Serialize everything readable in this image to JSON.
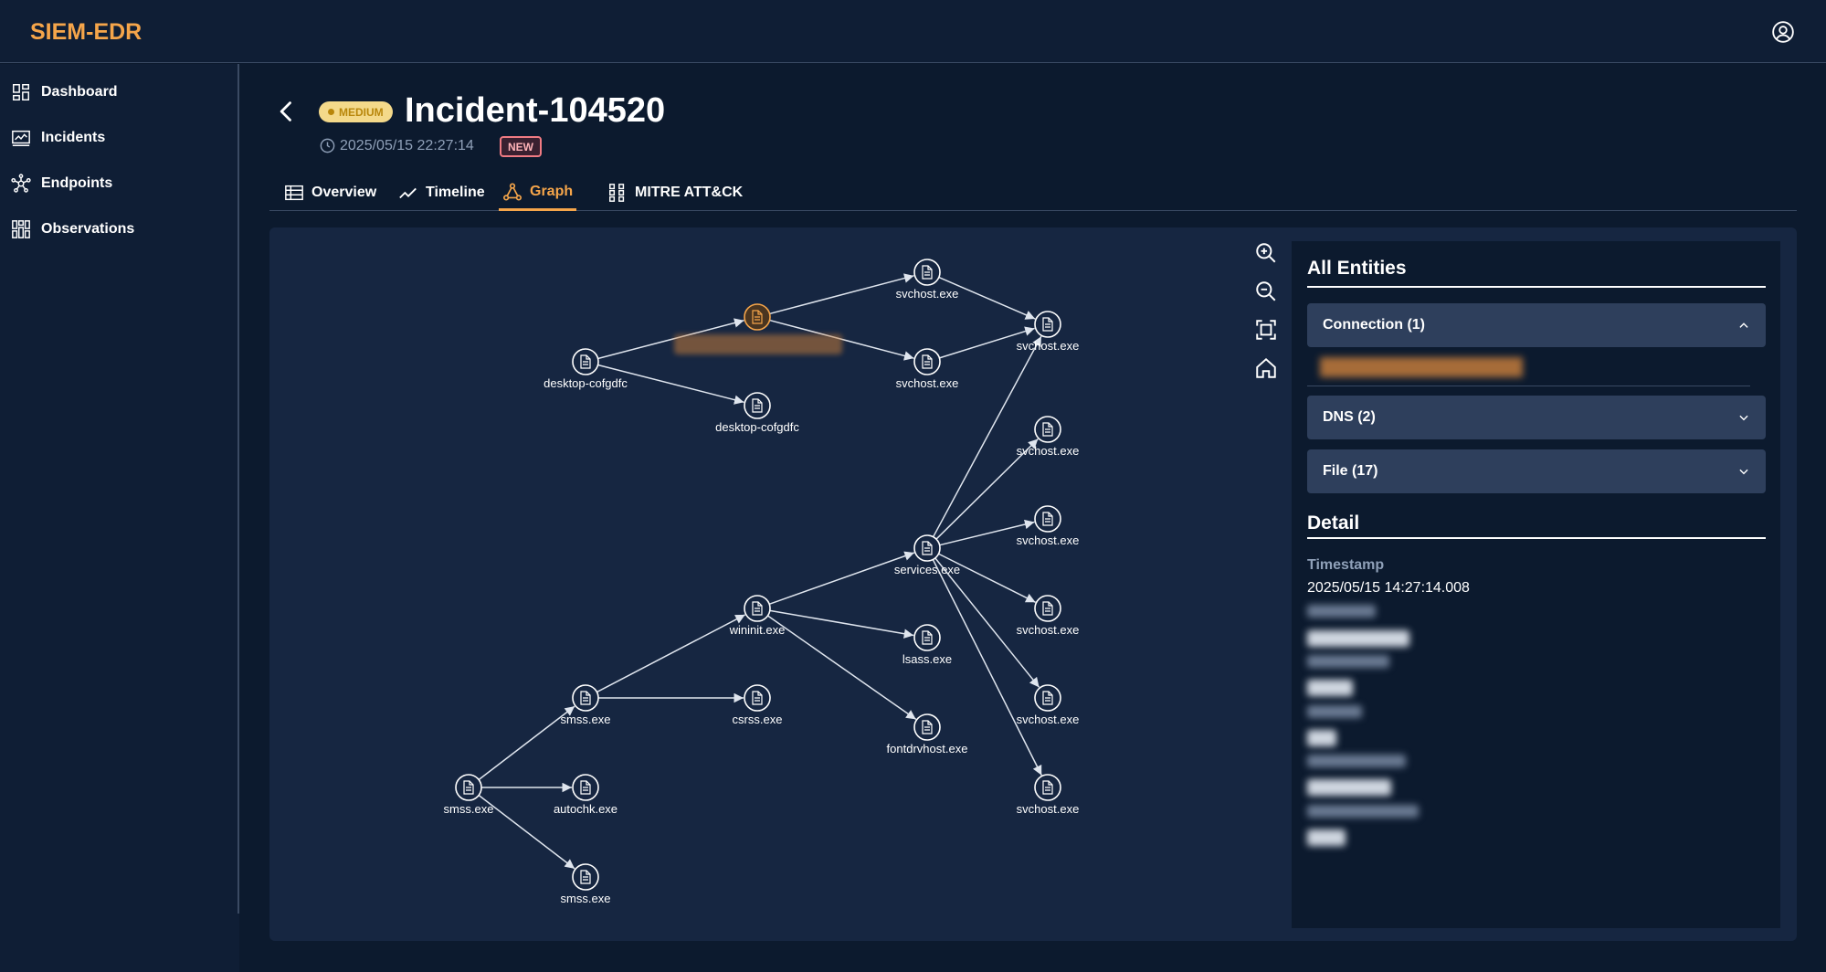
{
  "app": {
    "brand": "SIEM-EDR"
  },
  "sidebar": {
    "items": [
      {
        "label": "Dashboard",
        "icon": "dashboard-icon"
      },
      {
        "label": "Incidents",
        "icon": "chart-icon"
      },
      {
        "label": "Endpoints",
        "icon": "network-icon"
      },
      {
        "label": "Observations",
        "icon": "grid-icon"
      }
    ]
  },
  "incident": {
    "severity": "MEDIUM",
    "title": "Incident-104520",
    "timestamp": "2025/05/15 22:27:14",
    "status": "NEW"
  },
  "tabs": [
    {
      "label": "Overview",
      "icon": "table-icon",
      "active": false
    },
    {
      "label": "Timeline",
      "icon": "trend-icon",
      "active": false
    },
    {
      "label": "Graph",
      "icon": "graph-icon",
      "active": true
    },
    {
      "label": "MITRE ATT&CK",
      "icon": "grid-icon",
      "active": false
    }
  ],
  "graph": {
    "nodes": [
      {
        "id": "n1",
        "label": "desktop-cofgdfc"
      },
      {
        "id": "n2",
        "label": "",
        "highlighted": true
      },
      {
        "id": "n3",
        "label": "desktop-cofgdfc"
      },
      {
        "id": "n4",
        "label": "svchost.exe"
      },
      {
        "id": "n5",
        "label": "svchost.exe"
      },
      {
        "id": "n6",
        "label": "svchost.exe"
      },
      {
        "id": "n7",
        "label": "svchost.exe"
      },
      {
        "id": "n8",
        "label": "svchost.exe"
      },
      {
        "id": "n9",
        "label": "services.exe"
      },
      {
        "id": "n10",
        "label": "svchost.exe"
      },
      {
        "id": "n11",
        "label": "wininit.exe"
      },
      {
        "id": "n12",
        "label": "lsass.exe"
      },
      {
        "id": "n13",
        "label": "smss.exe"
      },
      {
        "id": "n14",
        "label": "csrss.exe"
      },
      {
        "id": "n15",
        "label": "svchost.exe"
      },
      {
        "id": "n16",
        "label": "fontdrvhost.exe"
      },
      {
        "id": "n17",
        "label": "smss.exe"
      },
      {
        "id": "n18",
        "label": "autochk.exe"
      },
      {
        "id": "n19",
        "label": "svchost.exe"
      },
      {
        "id": "n20",
        "label": "smss.exe"
      }
    ],
    "edges": [
      [
        "n1",
        "n2"
      ],
      [
        "n1",
        "n3"
      ],
      [
        "n2",
        "n4"
      ],
      [
        "n2",
        "n5"
      ],
      [
        "n4",
        "n6"
      ],
      [
        "n5",
        "n6"
      ],
      [
        "n9",
        "n6"
      ],
      [
        "n9",
        "n7"
      ],
      [
        "n9",
        "n8"
      ],
      [
        "n9",
        "n10"
      ],
      [
        "n9",
        "n15"
      ],
      [
        "n9",
        "n19"
      ],
      [
        "n11",
        "n9"
      ],
      [
        "n11",
        "n12"
      ],
      [
        "n11",
        "n16"
      ],
      [
        "n13",
        "n11"
      ],
      [
        "n13",
        "n14"
      ],
      [
        "n17",
        "n13"
      ],
      [
        "n17",
        "n18"
      ],
      [
        "n17",
        "n20"
      ]
    ],
    "controls": [
      "zoom-in-icon",
      "zoom-out-icon",
      "fit-view-icon",
      "home-icon"
    ]
  },
  "entities": {
    "title": "All Entities",
    "sections": [
      {
        "label": "Connection (1)",
        "expanded": true
      },
      {
        "label": "DNS (2)",
        "expanded": false
      },
      {
        "label": "File (17)",
        "expanded": false
      }
    ]
  },
  "detail": {
    "title": "Detail",
    "timestamp_label": "Timestamp",
    "timestamp_value": "2025/05/15 14:27:14.008"
  },
  "colors": {
    "accent": "#f5a54a",
    "background": "#0c1a2e",
    "panel": "#162641"
  }
}
